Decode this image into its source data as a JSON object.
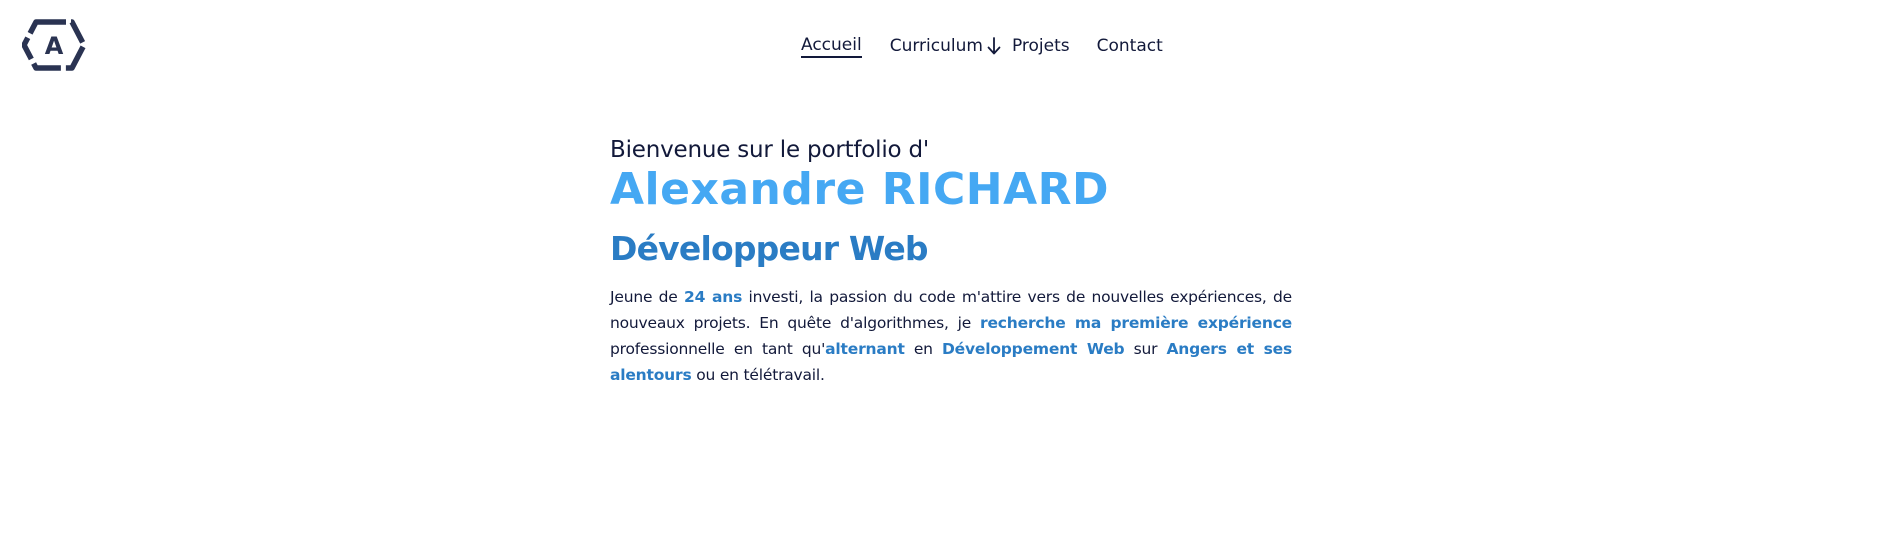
{
  "logo": {
    "letter": "A",
    "icon": "hexagon-logo-icon"
  },
  "nav": {
    "items": [
      {
        "label": "Accueil",
        "active": true
      },
      {
        "label": "Curriculum",
        "icon": "arrow-down-icon"
      },
      {
        "label": "Projets"
      },
      {
        "label": "Contact"
      }
    ]
  },
  "hero": {
    "welcome": "Bienvenue sur le portfolio d'",
    "name": "Alexandre RICHARD",
    "role": "Développeur Web",
    "bio": {
      "p1": "Jeune de ",
      "h1": "24 ans",
      "p2": " investi, la passion du code m'attire vers de nouvelles expériences, de nouveaux projets. En quête d'algorithmes, je ",
      "h2": "recherche ma première expérience",
      "p3": " professionnelle en tant qu'",
      "h3": "alternant",
      "p4": " en ",
      "h4": "Développement Web",
      "p5": " sur ",
      "h5": "Angers et ses alentours",
      "p6": " ou en télétravail."
    }
  },
  "colors": {
    "text": "#12193a",
    "accent_light": "#45a8f3",
    "accent_dark": "#2a7cc4"
  }
}
